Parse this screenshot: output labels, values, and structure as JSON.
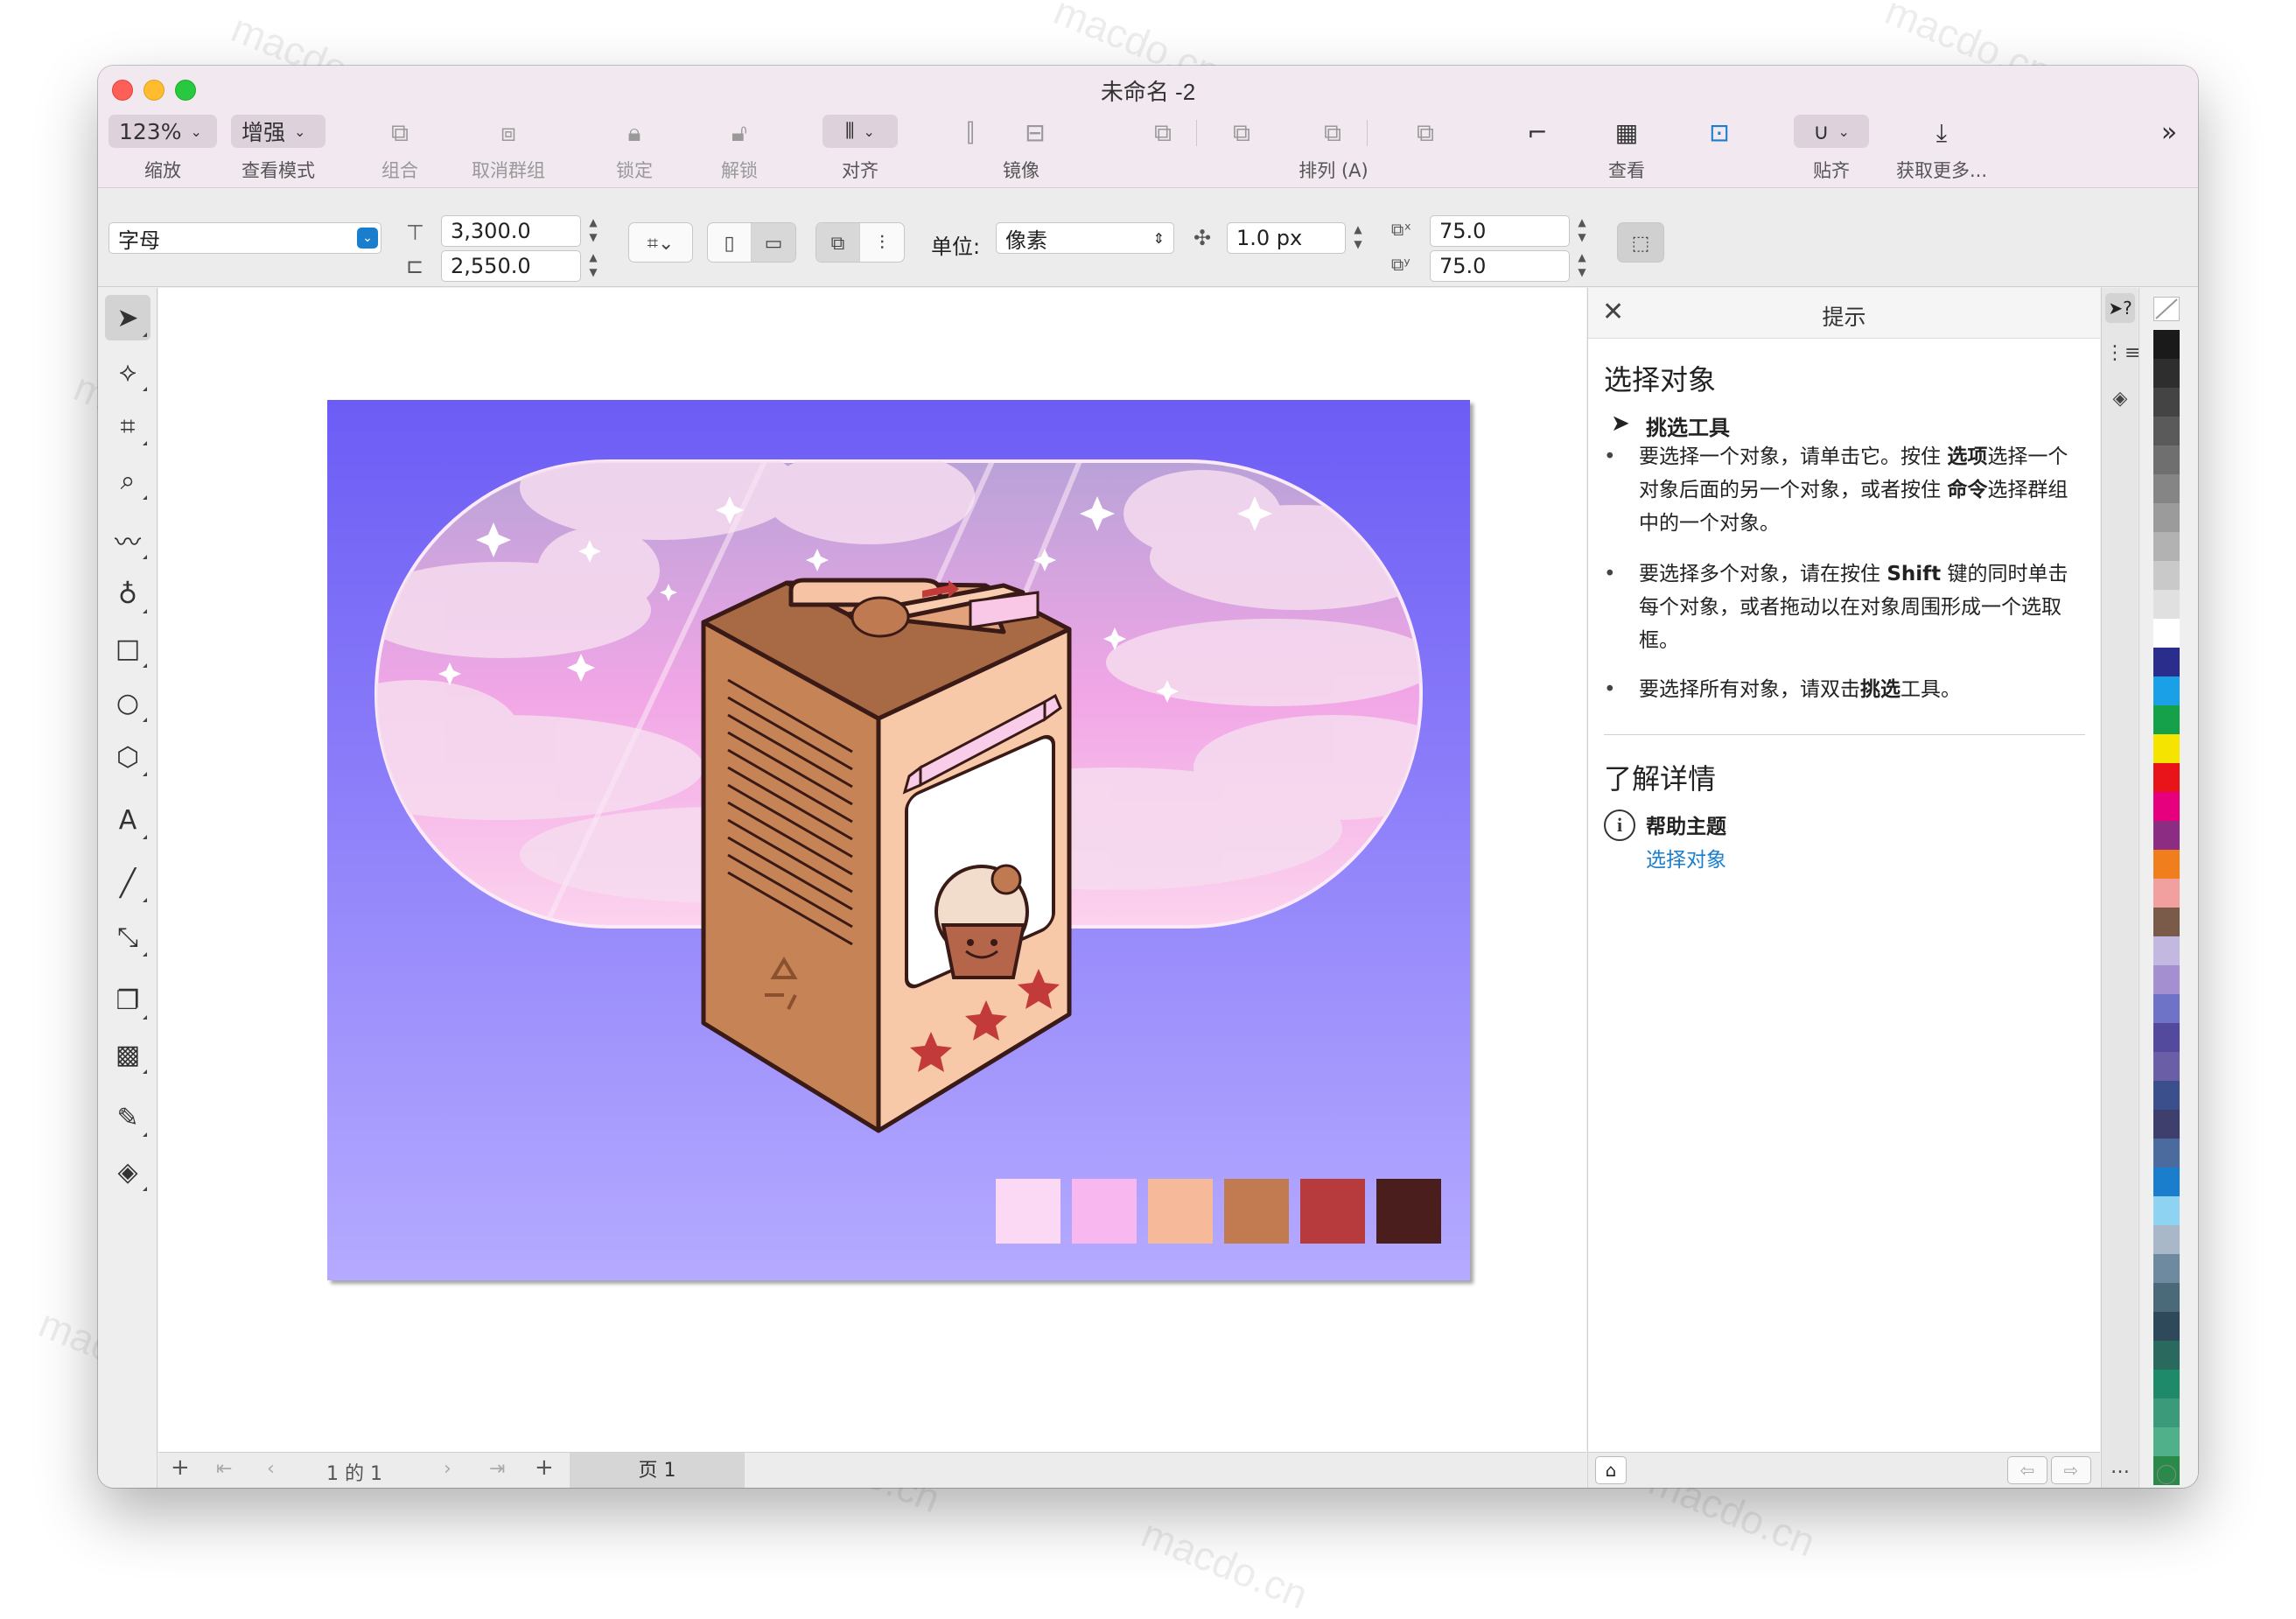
{
  "watermark": "macdo.cn",
  "window": {
    "title": "未命名 -2"
  },
  "toolbar": {
    "zoom_value": "123%",
    "zoom_label": "缩放",
    "view_mode_value": "增强",
    "view_mode_label": "查看模式",
    "group_label": "组合",
    "ungroup_label": "取消群组",
    "lock_label": "锁定",
    "unlock_label": "解锁",
    "align_label": "对齐",
    "mirror_label": "镜像",
    "arrange_label": "排列 (A)",
    "view_label": "查看",
    "snap_label": "贴齐",
    "get_more_label": "获取更多..."
  },
  "properties": {
    "preset_value": "字母",
    "width_value": "3,300.0",
    "height_value": "2,550.0",
    "units_label": "单位:",
    "units_value": "像素",
    "nudge_value": "1.0 px",
    "dup_x_value": "75.0",
    "dup_y_value": "75.0"
  },
  "status": {
    "page_counter": "1 的 1",
    "page_tab": "页 1"
  },
  "hints": {
    "panel_title": "提示",
    "section_title": "选择对象",
    "tool_name": "挑选工具",
    "bullets": [
      {
        "pre": "要选择一个对象，请单击它。按住 ",
        "b1": "选项",
        "mid": "选择一个对象后面的另一个对象，或者按住 ",
        "b2": "命令",
        "post": "选择群组中的一个对象。"
      },
      {
        "pre": "要选择多个对象，请在按住 ",
        "b1": "Shift",
        "mid": " 键的同时单击每个对象，或者拖动以在对象周围形成一个选取框。",
        "b2": "",
        "post": ""
      },
      {
        "pre": "要选择所有对象，请双击",
        "b1": "挑选",
        "mid": "工具。",
        "b2": "",
        "post": ""
      }
    ],
    "learn_more_title": "了解详情",
    "help_topic_label": "帮助主题",
    "help_link": "选择对象"
  },
  "colors": {
    "title_bar": "#f2e8f0",
    "doc_bg_top": "#6c5cf5",
    "doc_bg_bottom": "#b5aaff",
    "link": "#1a7ecc",
    "artwork_swatches": [
      "#fbd8f4",
      "#f9b7ef",
      "#f6b99a",
      "#c27a50",
      "#b73a3d",
      "#4a1e1c"
    ],
    "palette": [
      "#1a1a1a",
      "#2e2e2e",
      "#444444",
      "#5a5a5a",
      "#6f6f6f",
      "#858585",
      "#9b9b9b",
      "#b2b2b2",
      "#c9c9c9",
      "#e0e0e0",
      "#ffffff",
      "#2a2d8c",
      "#1aa0e6",
      "#14a14a",
      "#f5e300",
      "#e8141a",
      "#e6007e",
      "#8c2c83",
      "#f07e1c",
      "#f29f9f",
      "#7a5a48",
      "#c3b8e0",
      "#a48fd0",
      "#6f73c8",
      "#534a9e",
      "#6a5fa6",
      "#3a4f8c",
      "#3f3f6e",
      "#4b6a9e",
      "#1a7ecc",
      "#8fd3f2",
      "#a8b8c8",
      "#6e8aa0",
      "#4a6a7a",
      "#2e4a5a",
      "#2a6a5e",
      "#1e8a6a",
      "#3a9a7a",
      "#50b08a",
      "#2a8a4a"
    ]
  },
  "icons": {
    "close": "close-icon",
    "pick": "pick-tool-icon",
    "info": "info-icon"
  }
}
